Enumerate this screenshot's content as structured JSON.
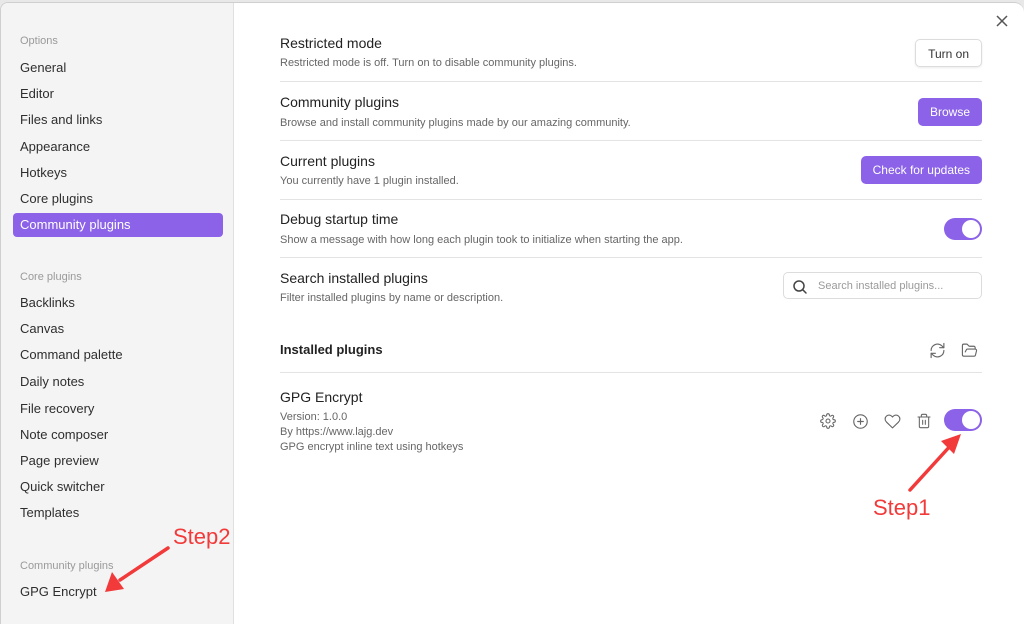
{
  "sidebar": {
    "groups": [
      {
        "title": "Options",
        "items": [
          "General",
          "Editor",
          "Files and links",
          "Appearance",
          "Hotkeys",
          "Core plugins",
          "Community plugins"
        ]
      },
      {
        "title": "Core plugins",
        "items": [
          "Backlinks",
          "Canvas",
          "Command palette",
          "Daily notes",
          "File recovery",
          "Note composer",
          "Page preview",
          "Quick switcher",
          "Templates"
        ]
      },
      {
        "title": "Community plugins",
        "items": [
          "GPG Encrypt"
        ]
      }
    ],
    "active_item": "Community plugins"
  },
  "settings": {
    "restricted_mode": {
      "title": "Restricted mode",
      "desc": "Restricted mode is off. Turn on to disable community plugins.",
      "button": "Turn on"
    },
    "community_plugins": {
      "title": "Community plugins",
      "desc": "Browse and install community plugins made by our amazing community.",
      "button": "Browse"
    },
    "current_plugins": {
      "title": "Current plugins",
      "desc": "You currently have 1 plugin installed.",
      "button": "Check for updates"
    },
    "debug_startup": {
      "title": "Debug startup time",
      "desc": "Show a message with how long each plugin took to initialize when starting the app.",
      "enabled": true
    },
    "search_plugins": {
      "title": "Search installed plugins",
      "desc": "Filter installed plugins by name or description.",
      "placeholder": "Search installed plugins...",
      "value": ""
    }
  },
  "installed": {
    "heading": "Installed plugins",
    "icons": [
      "reload-icon",
      "folder-icon"
    ],
    "plugins": [
      {
        "name": "GPG Encrypt",
        "version": "Version: 1.0.0",
        "author": "By https://www.lajg.dev",
        "desc": "GPG encrypt inline text using hotkeys",
        "enabled": true
      }
    ]
  },
  "annotations": {
    "step1": "Step1",
    "step2": "Step2",
    "color": "#f23a3a"
  },
  "theme": {
    "accent": "#8b62e8"
  }
}
